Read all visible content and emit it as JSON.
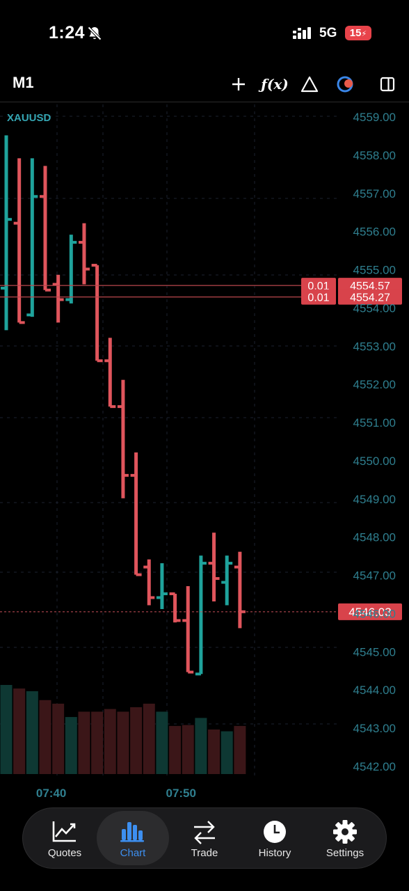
{
  "status_bar": {
    "time": "1:24",
    "network": "5G",
    "battery": "15"
  },
  "toolbar": {
    "timeframe": "M1",
    "indicator_label": "ƒ(x)"
  },
  "chart": {
    "symbol": "XAUUSD"
  },
  "chart_data": {
    "type": "ohlc",
    "symbol": "XAUUSD",
    "timeframe": "M1",
    "ylim": [
      4541.6,
      4559.2
    ],
    "y_ticks": [
      "4559.00",
      "4558.00",
      "4557.00",
      "4556.00",
      "4555.00",
      "4554.00",
      "4553.00",
      "4552.00",
      "4551.00",
      "4550.00",
      "4549.00",
      "4548.00",
      "4547.00",
      "4546.00",
      "4545.00",
      "4544.00",
      "4543.00",
      "4542.00"
    ],
    "x_ticks": [
      {
        "label": "07:40",
        "bar": 4
      },
      {
        "label": "07:50",
        "bar": 14
      }
    ],
    "bars": [
      {
        "o": 4554.5,
        "h": 4558.5,
        "l": 4553.4,
        "c": 4556.3,
        "dir": "up"
      },
      {
        "o": 4556.2,
        "h": 4557.9,
        "l": 4553.6,
        "c": 4553.6,
        "dir": "down"
      },
      {
        "o": 4553.8,
        "h": 4557.9,
        "l": 4553.75,
        "c": 4556.9,
        "dir": "up"
      },
      {
        "o": 4556.9,
        "h": 4557.7,
        "l": 4554.45,
        "c": 4554.45,
        "dir": "down"
      },
      {
        "o": 4554.6,
        "h": 4554.85,
        "l": 4553.6,
        "c": 4554.2,
        "dir": "down"
      },
      {
        "o": 4554.2,
        "h": 4555.9,
        "l": 4554.1,
        "c": 4555.7,
        "dir": "up"
      },
      {
        "o": 4555.7,
        "h": 4556.2,
        "l": 4554.6,
        "c": 4555.0,
        "dir": "down"
      },
      {
        "o": 4555.1,
        "h": 4555.1,
        "l": 4552.6,
        "c": 4552.6,
        "dir": "down"
      },
      {
        "o": 4552.6,
        "h": 4553.2,
        "l": 4551.4,
        "c": 4551.4,
        "dir": "down"
      },
      {
        "o": 4551.4,
        "h": 4552.1,
        "l": 4549.0,
        "c": 4549.6,
        "dir": "down"
      },
      {
        "o": 4549.6,
        "h": 4550.2,
        "l": 4547.0,
        "c": 4547.0,
        "dir": "down"
      },
      {
        "o": 4547.2,
        "h": 4547.4,
        "l": 4546.2,
        "c": 4546.4,
        "dir": "down"
      },
      {
        "o": 4546.4,
        "h": 4547.3,
        "l": 4546.1,
        "c": 4546.5,
        "dir": "up"
      },
      {
        "o": 4546.5,
        "h": 4546.5,
        "l": 4545.75,
        "c": 4545.8,
        "dir": "down"
      },
      {
        "o": 4545.8,
        "h": 4546.7,
        "l": 4544.45,
        "c": 4544.45,
        "dir": "down"
      },
      {
        "o": 4544.4,
        "h": 4547.5,
        "l": 4544.4,
        "c": 4547.3,
        "dir": "up"
      },
      {
        "o": 4547.3,
        "h": 4548.1,
        "l": 4546.3,
        "c": 4546.9,
        "dir": "down"
      },
      {
        "o": 4546.8,
        "h": 4547.5,
        "l": 4546.2,
        "c": 4547.3,
        "dir": "up"
      },
      {
        "o": 4547.2,
        "h": 4547.6,
        "l": 4545.6,
        "c": 4546.03,
        "dir": "down"
      }
    ],
    "volumes": [
      1.0,
      0.96,
      0.93,
      0.83,
      0.79,
      0.64,
      0.7,
      0.7,
      0.73,
      0.7,
      0.75,
      0.79,
      0.7,
      0.54,
      0.55,
      0.63,
      0.5,
      0.48,
      0.54
    ],
    "order_lines": [
      {
        "lots": "0.01",
        "price": "4554.57"
      },
      {
        "lots": "0.01",
        "price": "4554.27"
      }
    ],
    "current_price": "4546.03",
    "colors": {
      "up": "#1fa39c",
      "down": "#e0555c",
      "up_vol": "#0e3833",
      "down_vol": "#3b1618",
      "axis_text": "#2f7f8f",
      "grid": "#1c2230",
      "accent": "#d8434b"
    }
  },
  "nav": {
    "items": [
      {
        "key": "quotes",
        "label": "Quotes",
        "icon": "quotes-chart-icon"
      },
      {
        "key": "chart",
        "label": "Chart",
        "icon": "bar-chart-icon",
        "active": true
      },
      {
        "key": "trade",
        "label": "Trade",
        "icon": "swap-arrows-icon"
      },
      {
        "key": "history",
        "label": "History",
        "icon": "clock-icon"
      },
      {
        "key": "settings",
        "label": "Settings",
        "icon": "gear-icon"
      }
    ]
  }
}
